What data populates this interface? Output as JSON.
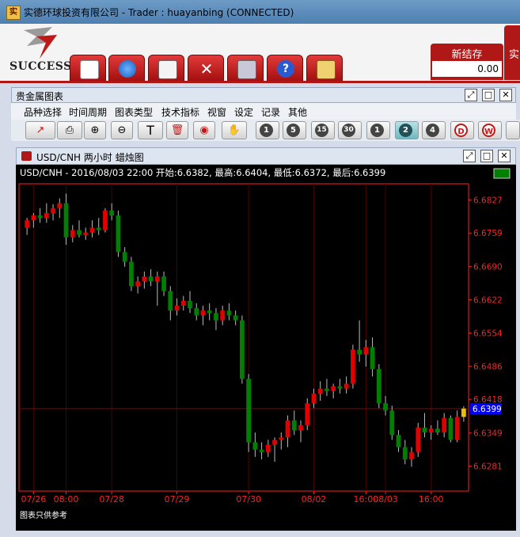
{
  "window": {
    "title": "实德环球投资有限公司 - Trader : huayanbing (CONNECTED)",
    "app_icon": "shide-app-icon"
  },
  "logo": {
    "text": "SUCCESS"
  },
  "toolbar_top": {
    "buttons": [
      {
        "name": "chart-doc-icon"
      },
      {
        "name": "refresh-arrows-icon"
      },
      {
        "name": "edit-document-icon"
      },
      {
        "name": "tools-icon"
      },
      {
        "name": "exit-door-icon"
      },
      {
        "name": "help-icon",
        "glyph": "?"
      },
      {
        "name": "warning-clipboard-icon"
      }
    ]
  },
  "account": {
    "new_label": "新结存",
    "new_value": "0.00",
    "right_label": "实"
  },
  "panel": {
    "title": "贵金属图表",
    "menus": [
      "品种选择",
      "时间周期",
      "图表类型",
      "技术指标",
      "视窗",
      "设定",
      "记录",
      "其他"
    ]
  },
  "chart_toolbar": {
    "tools": [
      {
        "name": "line-chart-tool-icon",
        "glyph": "↗"
      },
      {
        "name": "print-icon",
        "glyph": "⎙"
      },
      {
        "name": "zoom-in-icon",
        "glyph": "⊕"
      },
      {
        "name": "zoom-out-icon",
        "glyph": "⊖"
      },
      {
        "name": "text-tool-icon",
        "glyph": "T"
      },
      {
        "name": "delete-icon",
        "glyph": "🗑"
      },
      {
        "name": "eye-icon",
        "glyph": "◉"
      },
      {
        "name": "hand-icon",
        "glyph": "✋"
      }
    ],
    "periods": [
      {
        "name": "period-1-button",
        "label": "1"
      },
      {
        "name": "period-5-button",
        "label": "5"
      },
      {
        "name": "period-15-button",
        "label": "15"
      },
      {
        "name": "period-30-button",
        "label": "30"
      },
      {
        "name": "period-h1-button",
        "label": "1"
      },
      {
        "name": "period-h2-button",
        "label": "2"
      },
      {
        "name": "period-h4-button",
        "label": "4"
      },
      {
        "name": "period-d-button",
        "label": "D"
      },
      {
        "name": "period-w-button",
        "label": "W"
      }
    ]
  },
  "chart_window": {
    "title": "USD/CNH 两小时 蜡烛图",
    "info": "USD/CNH - 2016/08/03 22:00 开始:6.6382, 最高:6.6404, 最低:6.6372, 最后:6.6399",
    "footer": "图表只供参考"
  },
  "colors": {
    "up": "#008000",
    "down": "#e00000",
    "axis": "#ff2020",
    "grid": "#4a0000",
    "last_price_bg": "#0000ff"
  },
  "chart_data": {
    "type": "candlestick",
    "symbol": "USD/CNH",
    "ylim": [
      6.623,
      6.686
    ],
    "y_ticks": [
      6.6827,
      6.6759,
      6.669,
      6.6622,
      6.6554,
      6.6486,
      6.6418,
      6.6349,
      6.6281
    ],
    "last_price": 6.6399,
    "x_labels": [
      {
        "label": "07/26",
        "index": 1
      },
      {
        "label": "08:00",
        "index": 6
      },
      {
        "label": "07/28",
        "index": 13
      },
      {
        "label": "07/29",
        "index": 23
      },
      {
        "label": "07/30",
        "index": 34
      },
      {
        "label": "08/02",
        "index": 44
      },
      {
        "label": "16:00",
        "index": 52
      },
      {
        "label": "08/03",
        "index": 55
      },
      {
        "label": "16:00",
        "index": 62
      }
    ],
    "candles": [
      {
        "o": 6.677,
        "h": 6.679,
        "l": 6.6755,
        "c": 6.6785
      },
      {
        "o": 6.6785,
        "h": 6.68,
        "l": 6.677,
        "c": 6.6795
      },
      {
        "o": 6.6795,
        "h": 6.681,
        "l": 6.678,
        "c": 6.679
      },
      {
        "o": 6.679,
        "h": 6.682,
        "l": 6.678,
        "c": 6.68
      },
      {
        "o": 6.68,
        "h": 6.6818,
        "l": 6.6785,
        "c": 6.681
      },
      {
        "o": 6.681,
        "h": 6.683,
        "l": 6.679,
        "c": 6.682
      },
      {
        "o": 6.682,
        "h": 6.684,
        "l": 6.6735,
        "c": 6.675
      },
      {
        "o": 6.675,
        "h": 6.6775,
        "l": 6.674,
        "c": 6.6765
      },
      {
        "o": 6.6765,
        "h": 6.6785,
        "l": 6.675,
        "c": 6.6755
      },
      {
        "o": 6.6755,
        "h": 6.677,
        "l": 6.6745,
        "c": 6.676
      },
      {
        "o": 6.676,
        "h": 6.6785,
        "l": 6.675,
        "c": 6.677
      },
      {
        "o": 6.677,
        "h": 6.679,
        "l": 6.6755,
        "c": 6.6765
      },
      {
        "o": 6.6765,
        "h": 6.681,
        "l": 6.676,
        "c": 6.6805
      },
      {
        "o": 6.6805,
        "h": 6.682,
        "l": 6.6785,
        "c": 6.6795
      },
      {
        "o": 6.6795,
        "h": 6.6805,
        "l": 6.671,
        "c": 6.672
      },
      {
        "o": 6.672,
        "h": 6.673,
        "l": 6.669,
        "c": 6.67
      },
      {
        "o": 6.67,
        "h": 6.671,
        "l": 6.664,
        "c": 6.665
      },
      {
        "o": 6.665,
        "h": 6.667,
        "l": 6.6635,
        "c": 6.666
      },
      {
        "o": 6.666,
        "h": 6.668,
        "l": 6.6645,
        "c": 6.667
      },
      {
        "o": 6.667,
        "h": 6.6685,
        "l": 6.665,
        "c": 6.666
      },
      {
        "o": 6.666,
        "h": 6.668,
        "l": 6.661,
        "c": 6.667
      },
      {
        "o": 6.667,
        "h": 6.668,
        "l": 6.663,
        "c": 6.664
      },
      {
        "o": 6.664,
        "h": 6.665,
        "l": 6.658,
        "c": 6.66
      },
      {
        "o": 6.66,
        "h": 6.6625,
        "l": 6.659,
        "c": 6.661
      },
      {
        "o": 6.661,
        "h": 6.663,
        "l": 6.66,
        "c": 6.662
      },
      {
        "o": 6.662,
        "h": 6.664,
        "l": 6.6595,
        "c": 6.6605
      },
      {
        "o": 6.6605,
        "h": 6.6615,
        "l": 6.658,
        "c": 6.659
      },
      {
        "o": 6.659,
        "h": 6.661,
        "l": 6.657,
        "c": 6.66
      },
      {
        "o": 6.66,
        "h": 6.6615,
        "l": 6.658,
        "c": 6.6595
      },
      {
        "o": 6.6595,
        "h": 6.6605,
        "l": 6.656,
        "c": 6.658
      },
      {
        "o": 6.658,
        "h": 6.661,
        "l": 6.657,
        "c": 6.66
      },
      {
        "o": 6.66,
        "h": 6.6615,
        "l": 6.658,
        "c": 6.659
      },
      {
        "o": 6.659,
        "h": 6.66,
        "l": 6.657,
        "c": 6.658
      },
      {
        "o": 6.658,
        "h": 6.659,
        "l": 6.645,
        "c": 6.646
      },
      {
        "o": 6.646,
        "h": 6.647,
        "l": 6.631,
        "c": 6.633
      },
      {
        "o": 6.633,
        "h": 6.635,
        "l": 6.63,
        "c": 6.6315
      },
      {
        "o": 6.6315,
        "h": 6.633,
        "l": 6.6295,
        "c": 6.631
      },
      {
        "o": 6.631,
        "h": 6.6335,
        "l": 6.63,
        "c": 6.6325
      },
      {
        "o": 6.6325,
        "h": 6.634,
        "l": 6.629,
        "c": 6.6335
      },
      {
        "o": 6.6335,
        "h": 6.635,
        "l": 6.6315,
        "c": 6.634
      },
      {
        "o": 6.634,
        "h": 6.6385,
        "l": 6.632,
        "c": 6.6375
      },
      {
        "o": 6.6375,
        "h": 6.6395,
        "l": 6.6345,
        "c": 6.6355
      },
      {
        "o": 6.6355,
        "h": 6.6375,
        "l": 6.633,
        "c": 6.6365
      },
      {
        "o": 6.6365,
        "h": 6.642,
        "l": 6.6355,
        "c": 6.641
      },
      {
        "o": 6.641,
        "h": 6.644,
        "l": 6.64,
        "c": 6.643
      },
      {
        "o": 6.643,
        "h": 6.6455,
        "l": 6.6415,
        "c": 6.644
      },
      {
        "o": 6.644,
        "h": 6.646,
        "l": 6.6425,
        "c": 6.6435
      },
      {
        "o": 6.6435,
        "h": 6.645,
        "l": 6.642,
        "c": 6.6445
      },
      {
        "o": 6.6445,
        "h": 6.646,
        "l": 6.643,
        "c": 6.644
      },
      {
        "o": 6.644,
        "h": 6.6465,
        "l": 6.643,
        "c": 6.645
      },
      {
        "o": 6.645,
        "h": 6.653,
        "l": 6.644,
        "c": 6.652
      },
      {
        "o": 6.652,
        "h": 6.658,
        "l": 6.6495,
        "c": 6.651
      },
      {
        "o": 6.651,
        "h": 6.654,
        "l": 6.6485,
        "c": 6.6525
      },
      {
        "o": 6.6525,
        "h": 6.6545,
        "l": 6.6465,
        "c": 6.648
      },
      {
        "o": 6.648,
        "h": 6.649,
        "l": 6.64,
        "c": 6.641
      },
      {
        "o": 6.641,
        "h": 6.6425,
        "l": 6.6385,
        "c": 6.6395
      },
      {
        "o": 6.6395,
        "h": 6.6405,
        "l": 6.6335,
        "c": 6.6345
      },
      {
        "o": 6.6345,
        "h": 6.6355,
        "l": 6.631,
        "c": 6.632
      },
      {
        "o": 6.632,
        "h": 6.6335,
        "l": 6.6285,
        "c": 6.6295
      },
      {
        "o": 6.6295,
        "h": 6.632,
        "l": 6.628,
        "c": 6.631
      },
      {
        "o": 6.631,
        "h": 6.637,
        "l": 6.63,
        "c": 6.636
      },
      {
        "o": 6.636,
        "h": 6.639,
        "l": 6.634,
        "c": 6.635
      },
      {
        "o": 6.635,
        "h": 6.6365,
        "l": 6.6335,
        "c": 6.6358
      },
      {
        "o": 6.6358,
        "h": 6.6375,
        "l": 6.6345,
        "c": 6.635
      },
      {
        "o": 6.635,
        "h": 6.639,
        "l": 6.634,
        "c": 6.638
      },
      {
        "o": 6.638,
        "h": 6.6385,
        "l": 6.633,
        "c": 6.6335
      },
      {
        "o": 6.6335,
        "h": 6.6395,
        "l": 6.633,
        "c": 6.6382
      },
      {
        "o": 6.6382,
        "h": 6.6404,
        "l": 6.6372,
        "c": 6.6399
      }
    ]
  }
}
